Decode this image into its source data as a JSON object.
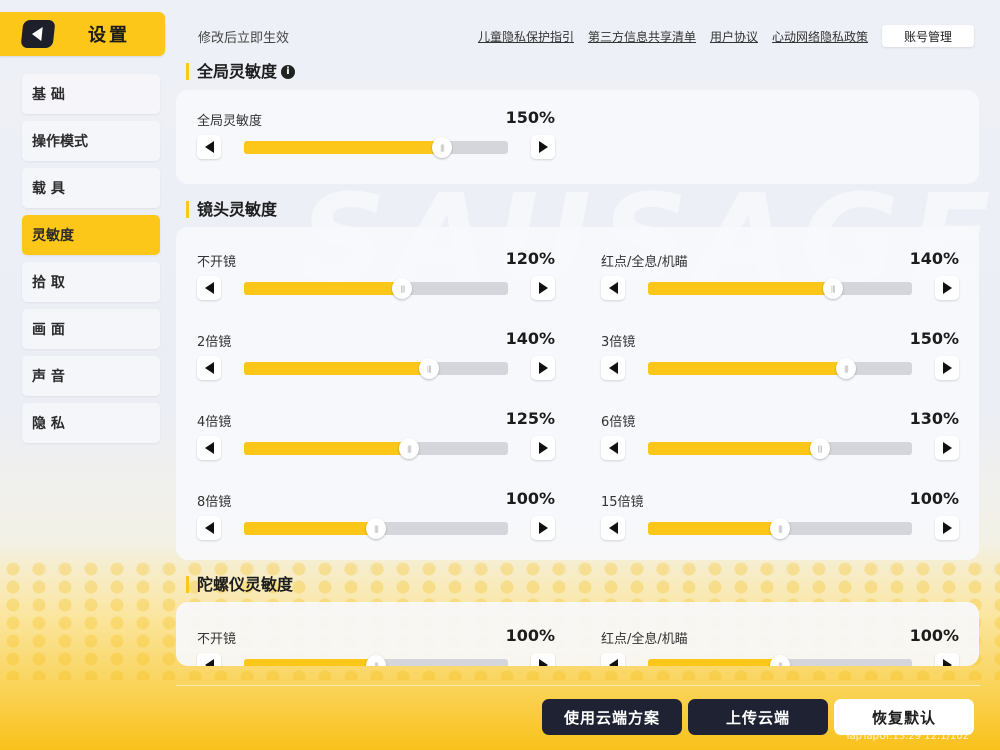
{
  "header": {
    "title": "设置",
    "hint": "修改后立即生效",
    "links": [
      "儿童隐私保护指引",
      "第三方信息共享清单",
      "用户协议",
      "心动网络隐私政策"
    ],
    "account_button": "账号管理"
  },
  "background_text": "SAUSAGE",
  "sidebar": {
    "items": [
      {
        "label": "基 础",
        "active": false
      },
      {
        "label": "操作模式",
        "active": false
      },
      {
        "label": "载 具",
        "active": false
      },
      {
        "label": "灵敏度",
        "active": true
      },
      {
        "label": "拾 取",
        "active": false
      },
      {
        "label": "画 面",
        "active": false
      },
      {
        "label": "声 音",
        "active": false
      },
      {
        "label": "隐 私",
        "active": false
      }
    ]
  },
  "sections": {
    "global": {
      "title": "全局灵敏度",
      "info_icon": "info-icon",
      "sliders": [
        {
          "label": "全局灵敏度",
          "value": "150%",
          "fill_fraction": 0.75
        }
      ]
    },
    "camera": {
      "title": "镜头灵敏度",
      "sliders": [
        {
          "label": "不开镜",
          "value": "120%",
          "fill_fraction": 0.6
        },
        {
          "label": "红点/全息/机瞄",
          "value": "140%",
          "fill_fraction": 0.7
        },
        {
          "label": "2倍镜",
          "value": "140%",
          "fill_fraction": 0.7
        },
        {
          "label": "3倍镜",
          "value": "150%",
          "fill_fraction": 0.75
        },
        {
          "label": "4倍镜",
          "value": "125%",
          "fill_fraction": 0.625
        },
        {
          "label": "6倍镜",
          "value": "130%",
          "fill_fraction": 0.65
        },
        {
          "label": "8倍镜",
          "value": "100%",
          "fill_fraction": 0.5
        },
        {
          "label": "15倍镜",
          "value": "100%",
          "fill_fraction": 0.5
        }
      ]
    },
    "gyro": {
      "title": "陀螺仪灵敏度",
      "sliders": [
        {
          "label": "不开镜",
          "value": "100%",
          "fill_fraction": 0.5
        },
        {
          "label": "红点/全息/机瞄",
          "value": "100%",
          "fill_fraction": 0.5
        }
      ]
    }
  },
  "bottom": {
    "cloud_plan": "使用云端方案",
    "upload": "上传云端",
    "restore": "恢复默认"
  },
  "footer_id": "TapTapUI:13.29 12.1/102",
  "colors": {
    "accent": "#fdc71a",
    "dark_button": "#1e2233",
    "track": "#d5d6db"
  }
}
